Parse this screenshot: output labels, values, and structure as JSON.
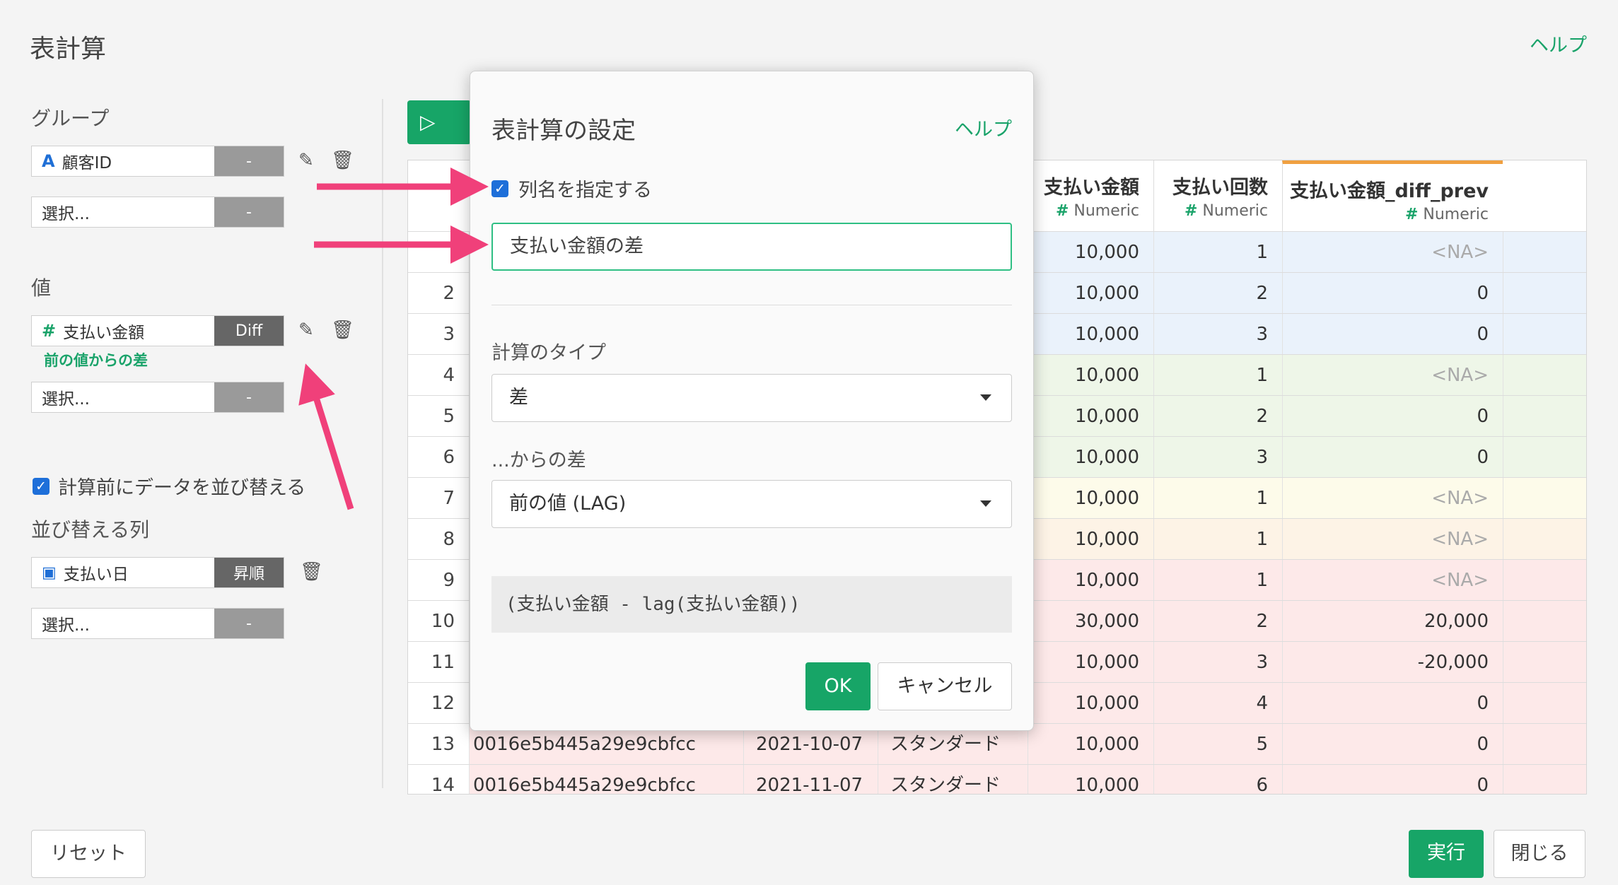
{
  "page": {
    "title": "表計算",
    "help": "ヘルプ"
  },
  "left": {
    "group_label": "グループ",
    "group_field": "顧客ID",
    "group_dash": "-",
    "group_select": "選択...",
    "group_select_dash": "-",
    "value_label": "値",
    "value_field": "支払い金額",
    "value_func": "Diff",
    "value_note": "前の値からの差",
    "value_select": "選択...",
    "value_select_dash": "-",
    "sort_check_label": "計算前にデータを並び替える",
    "sort_cols_label": "並び替える列",
    "sort_field": "支払い日",
    "sort_order": "昇順",
    "sort_select": "選択...",
    "sort_select_dash": "-"
  },
  "table": {
    "headers": [
      {
        "name": "支払い金額",
        "type": "Numeric"
      },
      {
        "name": "支払い回数",
        "type": "Numeric"
      },
      {
        "name": "支払い金額_diff_prev",
        "type": "Numeric"
      }
    ],
    "type_icon": "#",
    "rows": [
      {
        "n": "",
        "id": "",
        "date": "",
        "plan": "",
        "amt": "10,000",
        "cnt": "1",
        "diff": "<NA>",
        "na": true
      },
      {
        "n": "2",
        "id": "",
        "date": "",
        "plan": "",
        "amt": "10,000",
        "cnt": "2",
        "diff": "0"
      },
      {
        "n": "3",
        "id": "",
        "date": "",
        "plan": "",
        "amt": "10,000",
        "cnt": "3",
        "diff": "0"
      },
      {
        "n": "4",
        "id": "",
        "date": "",
        "plan": "",
        "amt": "10,000",
        "cnt": "1",
        "diff": "<NA>",
        "na": true
      },
      {
        "n": "5",
        "id": "",
        "date": "",
        "plan": "",
        "amt": "10,000",
        "cnt": "2",
        "diff": "0"
      },
      {
        "n": "6",
        "id": "",
        "date": "",
        "plan": "",
        "amt": "10,000",
        "cnt": "3",
        "diff": "0"
      },
      {
        "n": "7",
        "id": "",
        "date": "",
        "plan": "",
        "amt": "10,000",
        "cnt": "1",
        "diff": "<NA>",
        "na": true
      },
      {
        "n": "8",
        "id": "",
        "date": "",
        "plan": "",
        "amt": "10,000",
        "cnt": "1",
        "diff": "<NA>",
        "na": true
      },
      {
        "n": "9",
        "id": "",
        "date": "",
        "plan": "",
        "amt": "10,000",
        "cnt": "1",
        "diff": "<NA>",
        "na": true
      },
      {
        "n": "10",
        "id": "",
        "date": "",
        "plan": "",
        "amt": "30,000",
        "cnt": "2",
        "diff": "20,000"
      },
      {
        "n": "11",
        "id": "",
        "date": "",
        "plan": "",
        "amt": "10,000",
        "cnt": "3",
        "diff": "-20,000"
      },
      {
        "n": "12",
        "id": "",
        "date": "",
        "plan": "",
        "amt": "10,000",
        "cnt": "4",
        "diff": "0"
      },
      {
        "n": "13",
        "id": "0016e5b445a29e9cbfcc",
        "date": "2021-10-07",
        "plan": "スタンダード",
        "amt": "10,000",
        "cnt": "5",
        "diff": "0"
      },
      {
        "n": "14",
        "id": "0016e5b445a29e9cbfcc",
        "date": "2021-11-07",
        "plan": "スタンダード",
        "amt": "10,000",
        "cnt": "6",
        "diff": "0"
      }
    ],
    "row_colors": [
      "#eaf2fb",
      "#eaf2fb",
      "#eaf2fb",
      "#eef6e8",
      "#eef6e8",
      "#eef6e8",
      "#fdfbea",
      "#fdf3e6",
      "#fde9e9",
      "#fde9e9",
      "#fde9e9",
      "#fde9e9",
      "#fde9e9",
      "#fde9e9"
    ]
  },
  "dialog": {
    "title": "表計算の設定",
    "help": "ヘルプ",
    "checkbox_label": "列名を指定する",
    "column_name": "支払い金額の差",
    "calc_type_label": "計算のタイプ",
    "calc_type_value": "差",
    "from_label": "...からの差",
    "from_value": "前の値 (LAG)",
    "formula": "(支払い金額 - lag(支払い金額))",
    "ok": "OK",
    "cancel": "キャンセル"
  },
  "bottom": {
    "reset": "リセット",
    "run": "実行",
    "close": "閉じる"
  },
  "colors": {
    "accent": "#17a567",
    "arrow": "#f0407a",
    "header_accent": "#f0a040"
  }
}
